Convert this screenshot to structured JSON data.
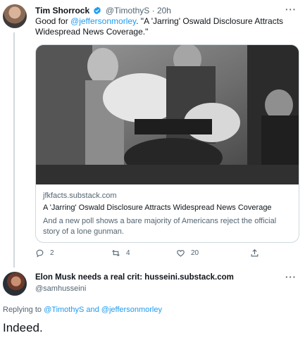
{
  "tweet1": {
    "author_name": "Tim Shorrock",
    "handle": "@TimothyS",
    "separator": "·",
    "time": "20h",
    "text_prefix": "Good for ",
    "mention": "@jeffersonmorley",
    "text_suffix": ". \"A 'Jarring' Oswald Disclosure Attracts Widespread News Coverage.\"",
    "more_label": "···",
    "card": {
      "domain": "jfkfacts.substack.com",
      "title": "A 'Jarring' Oswald Disclosure Attracts Widespread News Coverage",
      "description": "And a new poll shows a bare majority of Americans reject the official story of a lone gunman."
    },
    "actions": {
      "replies": "2",
      "retweets": "4",
      "likes": "20"
    }
  },
  "tweet2": {
    "author_name": "Elon Musk needs a real crit: husseini.substack.com",
    "handle": "@samhusseini",
    "more_label": "···",
    "replying_prefix": "Replying to ",
    "reply_user1": "@TimothyS",
    "reply_and": " and ",
    "reply_user2": "@jeffersonmorley",
    "text": "Indeed."
  },
  "colors": {
    "link": "#1d9bf0",
    "secondary_text": "#536471",
    "border": "#cfd9de"
  }
}
